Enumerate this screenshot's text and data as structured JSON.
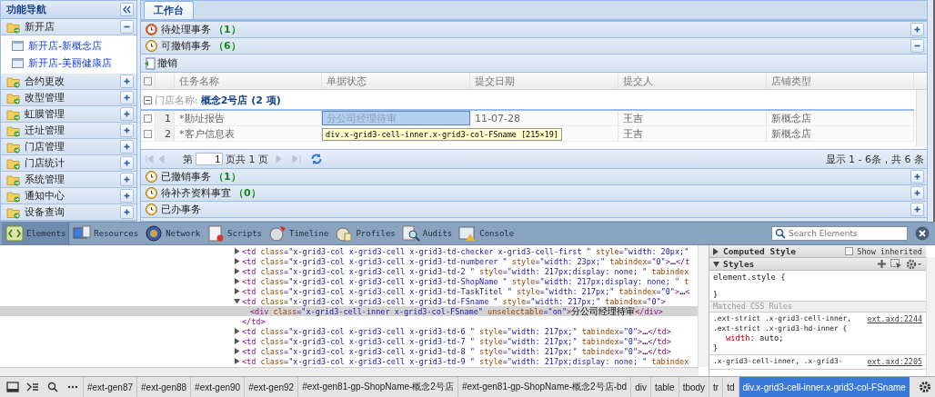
{
  "sidebar": {
    "title": "功能导航",
    "groups": [
      {
        "label": "新开店",
        "expanded": true,
        "children": [
          {
            "label": "新开店-新概念店"
          },
          {
            "label": "新开店-美丽健康店"
          }
        ]
      },
      {
        "label": "合约更改",
        "expanded": false
      },
      {
        "label": "改型管理",
        "expanded": false
      },
      {
        "label": "虹膜管理",
        "expanded": false
      },
      {
        "label": "迁址管理",
        "expanded": false
      },
      {
        "label": "门店管理",
        "expanded": false
      },
      {
        "label": "门店统计",
        "expanded": false
      },
      {
        "label": "系统管理",
        "expanded": false
      },
      {
        "label": "通知中心",
        "expanded": false
      },
      {
        "label": "设备查询",
        "expanded": false
      }
    ]
  },
  "tabs": [
    {
      "label": "工作台",
      "selected": true
    }
  ],
  "panels": [
    {
      "title": "待处理事务",
      "count": "（1）",
      "expanded": false
    },
    {
      "title": "可撤销事务",
      "count": "（6）",
      "expanded": true,
      "toolbar_button": "撤销",
      "grid": {
        "all_checked": false,
        "columns": [
          "任务名称",
          "单据状态",
          "提交日期",
          "提交人",
          "店铺类型"
        ],
        "group": {
          "label": "门店名称:",
          "value": "概念2号店 (2 项)",
          "expanded": true
        },
        "rows": [
          {
            "number": "1",
            "checked": false,
            "inspected": true,
            "cells": [
              "*勘址报告",
              "分公司经理待审",
              "11-07-28",
              "王吉",
              "新概念店"
            ]
          },
          {
            "number": "2",
            "checked": false,
            "inspected": false,
            "cells": [
              "*客户信息表",
              null,
              null,
              "王吉",
              "新概念店"
            ]
          }
        ],
        "inspector_tooltip": "div.x-grid3-cell-inner.x-grid3-col-FSname [215×19]"
      },
      "paging": {
        "before": "第",
        "page": "1",
        "after": "页共 1 页",
        "summary": "显示 1 - 6条，共 6 条"
      }
    },
    {
      "title": "已撤销事务",
      "count": "（1）",
      "expanded": false
    },
    {
      "title": "待补齐资料事宜",
      "count": "（0）",
      "expanded": false
    },
    {
      "title": "已办事务",
      "expanded": false
    }
  ],
  "devtools": {
    "tabs": [
      {
        "label": "Elements",
        "selected": true
      },
      {
        "label": "Resources",
        "selected": false
      },
      {
        "label": "Network",
        "selected": false
      },
      {
        "label": "Scripts",
        "selected": false
      },
      {
        "label": "Timeline",
        "selected": false
      },
      {
        "label": "Profiles",
        "selected": false
      },
      {
        "label": "Audits",
        "selected": false
      },
      {
        "label": "Console",
        "selected": false
      }
    ],
    "search": {
      "placeholder": "Search Elements"
    },
    "dom_lines": [
      {
        "expanded": false,
        "selected": false,
        "tokens": [
          {
            "kind": "tag",
            "t": "<td"
          },
          {
            "kind": "attr",
            "t": " class"
          },
          {
            "kind": "val",
            "t": "=\"x-grid3-col x-grid3-cell x-grid3-td-checker x-grid3-cell-first \""
          },
          {
            "kind": "attr",
            "t": " style"
          },
          {
            "kind": "val",
            "t": "=\"width: 20px;\""
          }
        ]
      },
      {
        "expanded": false,
        "selected": false,
        "tokens": [
          {
            "kind": "tag",
            "t": "<td"
          },
          {
            "kind": "attr",
            "t": " class"
          },
          {
            "kind": "val",
            "t": "=\"x-grid3-col x-grid3-cell x-grid3-td-numberer \""
          },
          {
            "kind": "attr",
            "t": " style"
          },
          {
            "kind": "val",
            "t": "=\"width: 23px;\""
          },
          {
            "kind": "attr",
            "t": " tabindex"
          },
          {
            "kind": "val",
            "t": "=\"0\""
          },
          {
            "kind": "tag",
            "t": ">"
          },
          {
            "kind": "text",
            "t": "…"
          },
          {
            "kind": "tag",
            "t": "</t"
          }
        ]
      },
      {
        "expanded": false,
        "selected": false,
        "tokens": [
          {
            "kind": "tag",
            "t": "<td"
          },
          {
            "kind": "attr",
            "t": " class"
          },
          {
            "kind": "val",
            "t": "=\"x-grid3-col x-grid3-cell x-grid3-td-2 \""
          },
          {
            "kind": "attr",
            "t": " style"
          },
          {
            "kind": "val",
            "t": "=\"width: 217px;display: none; \""
          },
          {
            "kind": "attr",
            "t": " tabindex"
          }
        ]
      },
      {
        "expanded": false,
        "selected": false,
        "tokens": [
          {
            "kind": "tag",
            "t": "<td"
          },
          {
            "kind": "attr",
            "t": " class"
          },
          {
            "kind": "val",
            "t": "=\"x-grid3-col x-grid3-cell x-grid3-td-ShopName \""
          },
          {
            "kind": "attr",
            "t": " style"
          },
          {
            "kind": "val",
            "t": "=\"width: 217px;display: none; \""
          },
          {
            "kind": "attr",
            "t": " t"
          }
        ]
      },
      {
        "expanded": false,
        "selected": false,
        "tokens": [
          {
            "kind": "tag",
            "t": "<td"
          },
          {
            "kind": "attr",
            "t": " class"
          },
          {
            "kind": "val",
            "t": "=\"x-grid3-col x-grid3-cell x-grid3-td-TaskTitel \""
          },
          {
            "kind": "attr",
            "t": " style"
          },
          {
            "kind": "val",
            "t": "=\"width: 217px;\""
          },
          {
            "kind": "attr",
            "t": " tabindex"
          },
          {
            "kind": "val",
            "t": "=\"0\""
          },
          {
            "kind": "tag",
            "t": ">"
          },
          {
            "kind": "text",
            "t": "…"
          },
          {
            "kind": "tag",
            "t": "<"
          }
        ]
      },
      {
        "expanded": true,
        "selected": false,
        "tokens": [
          {
            "kind": "tag",
            "t": "<td"
          },
          {
            "kind": "attr",
            "t": " class"
          },
          {
            "kind": "val",
            "t": "=\"x-grid3-col x-grid3-cell x-grid3-td-FSname \""
          },
          {
            "kind": "attr",
            "t": " style"
          },
          {
            "kind": "val",
            "t": "=\"width: 217px;\""
          },
          {
            "kind": "attr",
            "t": " tabindex"
          },
          {
            "kind": "val",
            "t": "=\"0\""
          },
          {
            "kind": "tag",
            "t": ">"
          }
        ],
        "children": [
          {
            "selected": true,
            "tokens": [
              {
                "kind": "tag",
                "t": "<div"
              },
              {
                "kind": "attr",
                "t": " class"
              },
              {
                "kind": "val",
                "t": "=\"x-grid3-cell-inner x-grid3-col-FSname\""
              },
              {
                "kind": "attr",
                "t": " unselectable"
              },
              {
                "kind": "val",
                "t": "=\"on\""
              },
              {
                "kind": "tag",
                "t": ">"
              },
              {
                "kind": "text",
                "t": "分公司经理待审"
              },
              {
                "kind": "tag",
                "t": "</div>"
              }
            ]
          }
        ],
        "close": [
          {
            "kind": "tag",
            "t": "</td>"
          }
        ]
      },
      {
        "expanded": false,
        "selected": false,
        "tokens": [
          {
            "kind": "tag",
            "t": "<td"
          },
          {
            "kind": "attr",
            "t": " class"
          },
          {
            "kind": "val",
            "t": "=\"x-grid3-col x-grid3-cell x-grid3-td-6 \""
          },
          {
            "kind": "attr",
            "t": " style"
          },
          {
            "kind": "val",
            "t": "=\"width: 217px;\""
          },
          {
            "kind": "attr",
            "t": " tabindex"
          },
          {
            "kind": "val",
            "t": "=\"0\""
          },
          {
            "kind": "tag",
            "t": ">"
          },
          {
            "kind": "text",
            "t": "…"
          },
          {
            "kind": "tag",
            "t": "</td>"
          }
        ]
      },
      {
        "expanded": false,
        "selected": false,
        "tokens": [
          {
            "kind": "tag",
            "t": "<td"
          },
          {
            "kind": "attr",
            "t": " class"
          },
          {
            "kind": "val",
            "t": "=\"x-grid3-col x-grid3-cell x-grid3-td-7 \""
          },
          {
            "kind": "attr",
            "t": " style"
          },
          {
            "kind": "val",
            "t": "=\"width: 217px;\""
          },
          {
            "kind": "attr",
            "t": " tabindex"
          },
          {
            "kind": "val",
            "t": "=\"0\""
          },
          {
            "kind": "tag",
            "t": ">"
          },
          {
            "kind": "text",
            "t": "…"
          },
          {
            "kind": "tag",
            "t": "</td>"
          }
        ]
      },
      {
        "expanded": false,
        "selected": false,
        "tokens": [
          {
            "kind": "tag",
            "t": "<td"
          },
          {
            "kind": "attr",
            "t": " class"
          },
          {
            "kind": "val",
            "t": "=\"x-grid3-col x-grid3-cell x-grid3-td-8 \""
          },
          {
            "kind": "attr",
            "t": " style"
          },
          {
            "kind": "val",
            "t": "=\"width: 217px;\""
          },
          {
            "kind": "attr",
            "t": " tabindex"
          },
          {
            "kind": "val",
            "t": "=\"0\""
          },
          {
            "kind": "tag",
            "t": ">"
          },
          {
            "kind": "text",
            "t": "…"
          },
          {
            "kind": "tag",
            "t": "</td>"
          }
        ]
      },
      {
        "expanded": false,
        "selected": false,
        "tokens": [
          {
            "kind": "tag",
            "t": "<td"
          },
          {
            "kind": "attr",
            "t": " class"
          },
          {
            "kind": "val",
            "t": "=\"x-grid3-col x-grid3-cell x-grid3-td-9 \""
          },
          {
            "kind": "attr",
            "t": " style"
          },
          {
            "kind": "val",
            "t": "=\"width: 217px;display: none; \""
          },
          {
            "kind": "attr",
            "t": " tabindex"
          }
        ]
      }
    ],
    "styles": {
      "computed": {
        "title": "Computed Style",
        "expanded": false
      },
      "show_inherited": {
        "label": "Show inherited",
        "checked": false
      },
      "styles_title": "Styles",
      "styles_expanded": true,
      "element_style": {
        "open": "element.style {",
        "close": "}"
      },
      "matched_title": "Matched CSS Rules",
      "rules": [
        {
          "selector": ".ext-strict .x-grid3-cell-inner, .ext-strict .x-grid3-hd-inner {",
          "source": "ext.axd:2244",
          "properties": [
            {
              "name": "width",
              "value": ": auto;"
            }
          ],
          "close": "}"
        },
        {
          "selector": ".x-grid3-cell-inner, .x-grid3-",
          "source": "ext.axd:2205"
        }
      ]
    },
    "breadcrumbs": [
      {
        "label": "#ext-gen87",
        "selected": false
      },
      {
        "label": "#ext-gen88",
        "selected": false
      },
      {
        "label": "#ext-gen90",
        "selected": false
      },
      {
        "label": "#ext-gen92",
        "selected": false
      },
      {
        "label": "#ext-gen81-gp-ShopName-概念2号店",
        "selected": false
      },
      {
        "label": "#ext-gen81-gp-ShopName-概念2号店-bd",
        "selected": false
      },
      {
        "label": "div",
        "selected": false
      },
      {
        "label": "table",
        "selected": false
      },
      {
        "label": "tbody",
        "selected": false
      },
      {
        "label": "tr",
        "selected": false
      },
      {
        "label": "td",
        "selected": false
      },
      {
        "label": "div.x-grid3-cell-inner.x-grid3-col-FSname",
        "selected": true
      }
    ]
  }
}
